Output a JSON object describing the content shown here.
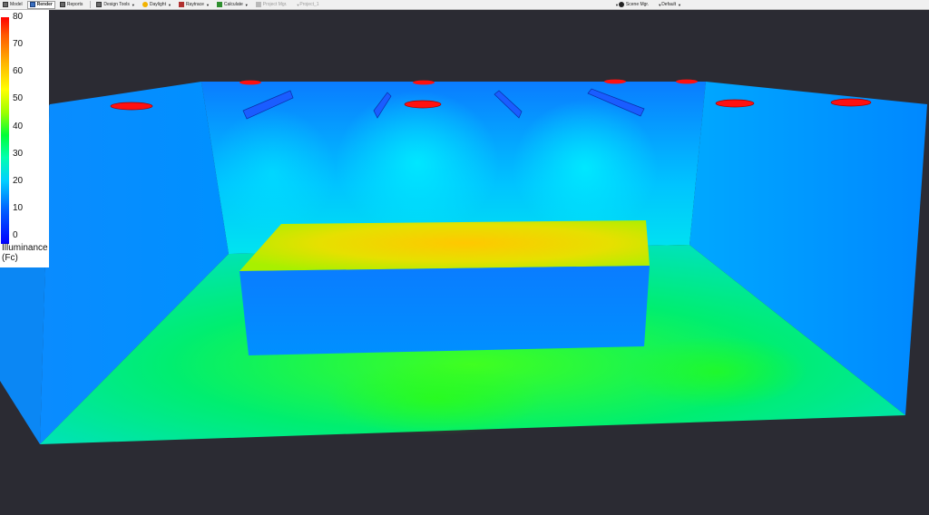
{
  "toolbar": {
    "items": [
      {
        "label": "Model",
        "icon": "model-icon"
      },
      {
        "label": "Render",
        "icon": "render-icon",
        "active": true
      },
      {
        "label": "Reports",
        "icon": "reports-icon"
      },
      {
        "label": "Design Tools",
        "icon": "design-tools-icon"
      },
      {
        "label": "Daylight",
        "icon": "daylight-icon"
      },
      {
        "label": "Raytrace",
        "icon": "raytrace-icon"
      },
      {
        "label": "Calculate",
        "icon": "calculate-icon"
      },
      {
        "label": "Project Mgr.",
        "icon": "project-manager-icon",
        "disabled": true
      },
      {
        "label": "Project_1",
        "disabled": true
      }
    ],
    "right": {
      "scene_label": "Scene Mgr.",
      "scene_value": "Default"
    }
  },
  "legend": {
    "ticks": [
      "80",
      "70",
      "60",
      "50",
      "40",
      "30",
      "20",
      "10",
      "0"
    ],
    "title_line1": "Illuminance",
    "title_line2": "(Fc)",
    "min": 0,
    "max": 80
  },
  "colors": {
    "background": "#2b2b33",
    "luminaire": "#ff0000",
    "wall": "#0a8cff",
    "floor": "#00e08a",
    "table_top": "#f0d000"
  }
}
